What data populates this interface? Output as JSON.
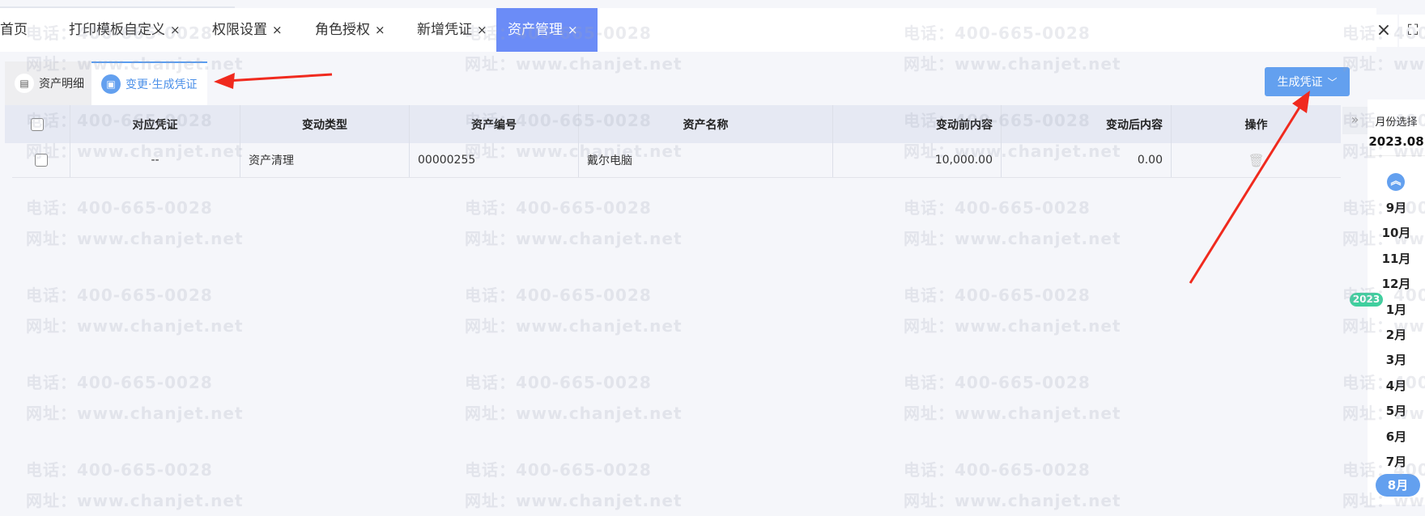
{
  "tabs": [
    {
      "label": "首页",
      "close": ""
    },
    {
      "label": "打印模板自定义",
      "close": "×"
    },
    {
      "label": "权限设置",
      "close": "×"
    },
    {
      "label": "角色授权",
      "close": "×"
    },
    {
      "label": "新增凭证",
      "close": "×"
    },
    {
      "label": "资产管理",
      "close": "×"
    }
  ],
  "window": {
    "close_icon": "×",
    "fullscreen_icon": "⛶"
  },
  "subtabs": [
    {
      "label": "资产明细",
      "icon": "list-icon"
    },
    {
      "label": "变更·生成凭证",
      "icon": "voucher-icon"
    }
  ],
  "toolbar": {
    "generate_label": "生成凭证",
    "chevron": "﹀"
  },
  "table": {
    "headers": [
      "对应凭证",
      "变动类型",
      "资产编号",
      "资产名称",
      "变动前内容",
      "变动后内容",
      "操作"
    ],
    "rows": [
      {
        "voucher": "--",
        "type": "资产清理",
        "code": "00000255",
        "name": "戴尔电脑",
        "before": "10,000.00",
        "after": "0.00",
        "action_icon": "trash-icon"
      }
    ]
  },
  "month_panel": {
    "title": "月份选择",
    "current": "2023.08",
    "year_badge": "2023",
    "months": [
      "9月",
      "10月",
      "11月",
      "12月",
      "1月",
      "2月",
      "3月",
      "4月",
      "5月",
      "6月",
      "7月",
      "8月"
    ],
    "selected": "8月"
  },
  "watermark": {
    "line1": "电话：400-665-0028",
    "line2": "网址：www.chanjet.net"
  },
  "colors": {
    "accent": "#63a0ef",
    "active_tab": "#6b8cf7",
    "badge": "#3fcf9e",
    "arrow": "#f02a1e"
  }
}
